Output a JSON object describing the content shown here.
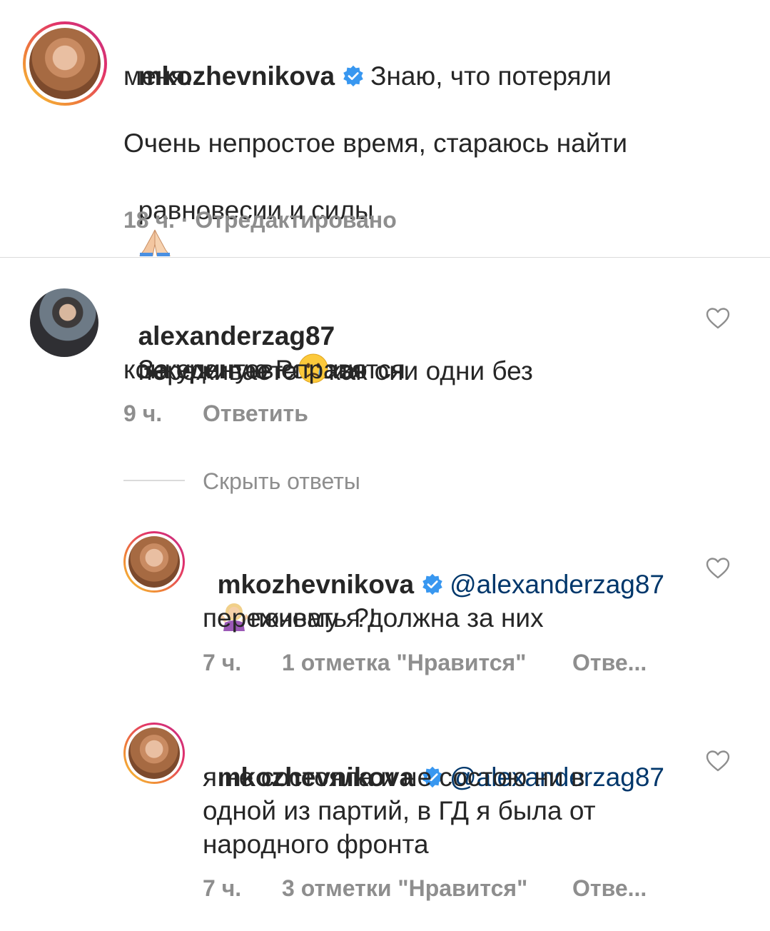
{
  "caption": {
    "username": "mkozhevnikova",
    "text_line1": "Знаю, что потеряли",
    "text_line2": "меня...",
    "text_line3": "Очень непростое время, стараюсь найти",
    "text_line4": "равновесии и силы",
    "time": "18 ч.",
    "edited": "· Отредактировано"
  },
  "comments": [
    {
      "username": "alexanderzag87",
      "line1": "За единую Россию",
      "line2a": "переживаете",
      "line2b": "как они одни без",
      "line3": "конкурентов справятся",
      "time": "9 ч.",
      "reply_label": "Ответить",
      "hide_replies_label": "Скрыть ответы"
    }
  ],
  "replies": [
    {
      "username": "mkozhevnikova",
      "mention": "@alexanderzag87",
      "line1": "почему я должна за них",
      "line2": "переживать ?!",
      "time": "7 ч.",
      "likes": "1 отметка \"Нравится\"",
      "reply_label": "Отве..."
    },
    {
      "username": "mkozhevnikova",
      "mention": "@alexanderzag87",
      "line1": "я не состояла и не состою ни в",
      "line2": "одной из партий, в ГД я была от",
      "line3": "народного фронта",
      "time": "7 ч.",
      "likes": "3 отметки \"Нравится\"",
      "reply_label": "Отве..."
    }
  ],
  "colors": {
    "verified": "#3897f0",
    "text": "#262626",
    "secondary": "#8e8e8e",
    "mention": "#00376b"
  }
}
